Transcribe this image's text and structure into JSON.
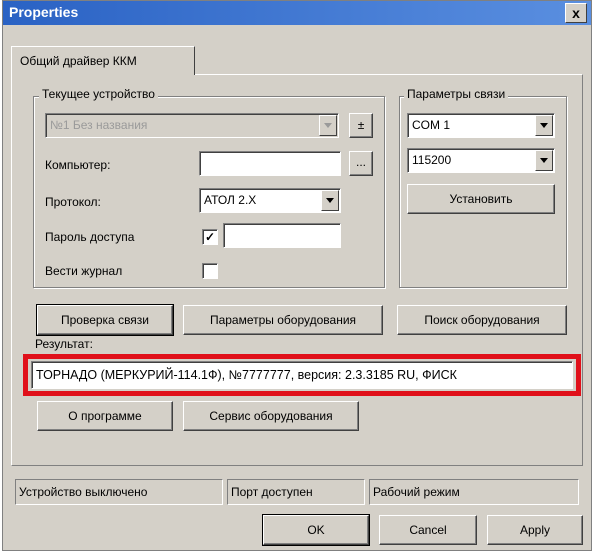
{
  "window": {
    "title": "Properties",
    "close_glyph": "x"
  },
  "tabs": [
    {
      "label": "Общий драйвер ККМ",
      "active": true
    }
  ],
  "current_device": {
    "group_label": "Текущее устройство",
    "device_select": "№1 Без названия",
    "add_remove_glyph": "±",
    "computer_label": "Компьютер:",
    "computer_value": "",
    "browse_glyph": "...",
    "protocol_label": "Протокол:",
    "protocol_value": "АТОЛ 2.X",
    "password_label": "Пароль доступа",
    "password_checked": true,
    "password_check_glyph": "✓",
    "password_value": "",
    "log_label": "Вести журнал",
    "log_checked": false
  },
  "connection": {
    "group_label": "Параметры связи",
    "port": "COM 1",
    "baud": "115200",
    "set_button": "Установить"
  },
  "actions": {
    "check_connection": "Проверка связи",
    "equipment_params": "Параметры оборудования",
    "find_equipment": "Поиск оборудования"
  },
  "result": {
    "label": "Результат:",
    "value": "ТОРНАДО (МЕРКУРИЙ-114.1Ф), №7777777, версия: 2.3.3185 RU, ФИСК",
    "highlight_color": "#e0101a"
  },
  "lower_buttons": {
    "about": "О программе",
    "service": "Сервис оборудования"
  },
  "status": {
    "device": "Устройство выключено",
    "port": "Порт доступен",
    "mode": "Рабочий режим"
  },
  "footer": {
    "ok": "OK",
    "cancel": "Cancel",
    "apply": "Apply"
  }
}
